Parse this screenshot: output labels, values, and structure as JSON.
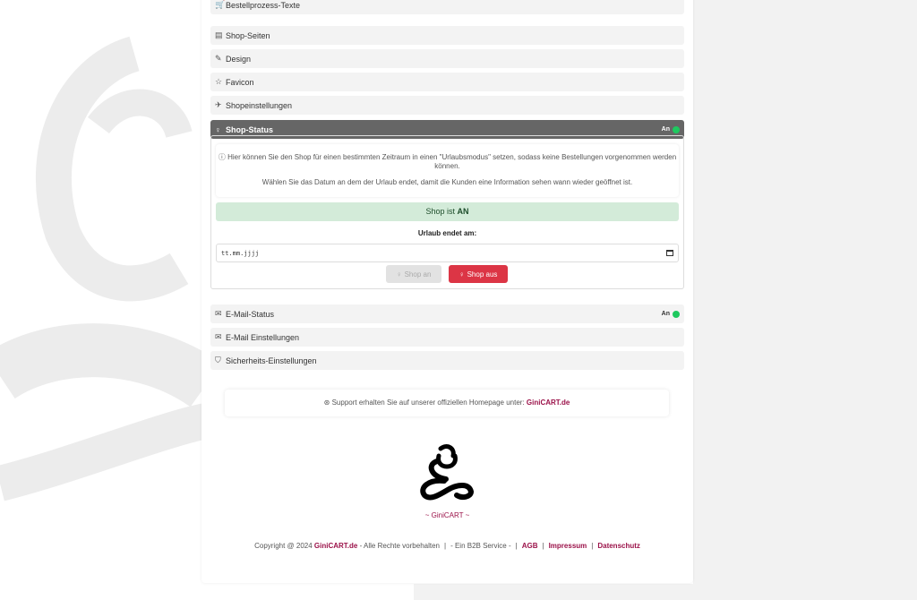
{
  "accordion": [
    {
      "icon": "cart-icon",
      "glyph": "🛒",
      "label": "Bestellprozess-Texte"
    },
    {
      "icon": "layout-icon",
      "glyph": "▤",
      "label": "Shop-Seiten"
    },
    {
      "icon": "brush-icon",
      "glyph": "✎",
      "label": "Design"
    },
    {
      "icon": "star-icon",
      "glyph": "☆",
      "label": "Favicon"
    },
    {
      "icon": "rocket-icon",
      "glyph": "✈",
      "label": "Shopeinstellungen"
    },
    {
      "icon": "lightbulb-icon",
      "glyph": "♀",
      "label": "Shop-Status",
      "status": "An",
      "active": true
    },
    {
      "icon": "email-icon",
      "glyph": "✉",
      "label": "E-Mail-Status",
      "status": "An"
    },
    {
      "icon": "envelope-open-icon",
      "glyph": "✉",
      "label": "E-Mail Einstellungen"
    },
    {
      "icon": "shield-icon",
      "glyph": "⛉",
      "label": "Sicherheits-Einstellungen"
    }
  ],
  "shop_status": {
    "info_line1": "Hier können Sie den Shop für einen bestimmten Zeitraum in einen \"Urlaubsmodus\" setzen, sodass keine Bestellungen vorgenommen werden können.",
    "info_line2": "Wählen Sie das Datum an dem der Urlaub endet, damit die Kunden eine Information sehen wann wieder geöffnet ist.",
    "alert_prefix": "Shop ist ",
    "alert_state": "AN",
    "date_label": "Urlaub endet am:",
    "date_placeholder": "tt.mm.jjjj",
    "btn_on": "Shop an",
    "btn_off": "Shop aus"
  },
  "support": {
    "text": "Support erhalten Sie auf unserer offiziellen Homepage unter: ",
    "link": "GiniCART.de"
  },
  "logo_text": "~ GiniCART ~",
  "footer": {
    "copyright": "Copyright @ 2024 ",
    "brand": "GiniCART.de",
    "rights": " -  Alle Rechte vorbehalten",
    "b2b": "- Ein B2B Service -",
    "agb": "AGB",
    "impressum": "Impressum",
    "datenschutz": "Datenschutz"
  },
  "colors": {
    "accent": "#9b1249",
    "active_header": "#666666",
    "status_on": "#1ec95f",
    "danger": "#dc3545",
    "success_bg": "#d3ebd9"
  }
}
